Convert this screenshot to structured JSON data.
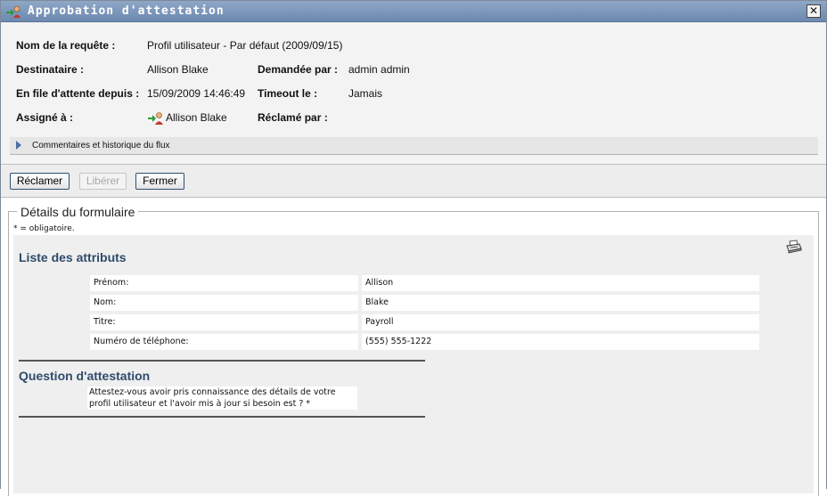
{
  "window": {
    "title": "Approbation d'attestation",
    "close_label": "✕",
    "title_icon": "user-approval-icon",
    "close_icon": "close-icon"
  },
  "request_info": {
    "request_name_label": "Nom de la requête :",
    "request_name_value": "Profil utilisateur - Par défaut (2009/09/15)",
    "recipient_label": "Destinataire :",
    "recipient_value": "Allison Blake",
    "requested_by_label": "Demandée par :",
    "requested_by_value": "admin admin",
    "queued_since_label": "En file d'attente depuis :",
    "queued_since_value": "15/09/2009 14:46:49",
    "timeout_label": "Timeout le :",
    "timeout_value": "Jamais",
    "assigned_to_label": "Assigné à :",
    "assigned_to_value": "Allison Blake",
    "claimed_by_label": "Réclamé par :",
    "claimed_by_value": ""
  },
  "history": {
    "label": "Commentaires et historique du flux"
  },
  "toolbar": {
    "claim_label": "Réclamer",
    "release_label": "Libérer",
    "close_label": "Fermer"
  },
  "form": {
    "legend": "Détails du formulaire",
    "required_note": "* = obligatoire.",
    "attributes_title": "Liste des attributs",
    "attributes": [
      {
        "label": "Prénom:",
        "value": "Allison"
      },
      {
        "label": "Nom:",
        "value": "Blake"
      },
      {
        "label": "Titre:",
        "value": "Payroll"
      },
      {
        "label": "Numéro de téléphone:",
        "value": "(555) 555-1222"
      }
    ],
    "question_title": "Question d'attestation",
    "question_text": "Attestez-vous avoir pris connaissance des détails de votre profil utilisateur et l'avoir mis à jour si besoin est ? *"
  },
  "colors": {
    "titlebar": "#7b95ba",
    "section_title": "#2f4b6b",
    "button_border": "#2f4f77"
  }
}
